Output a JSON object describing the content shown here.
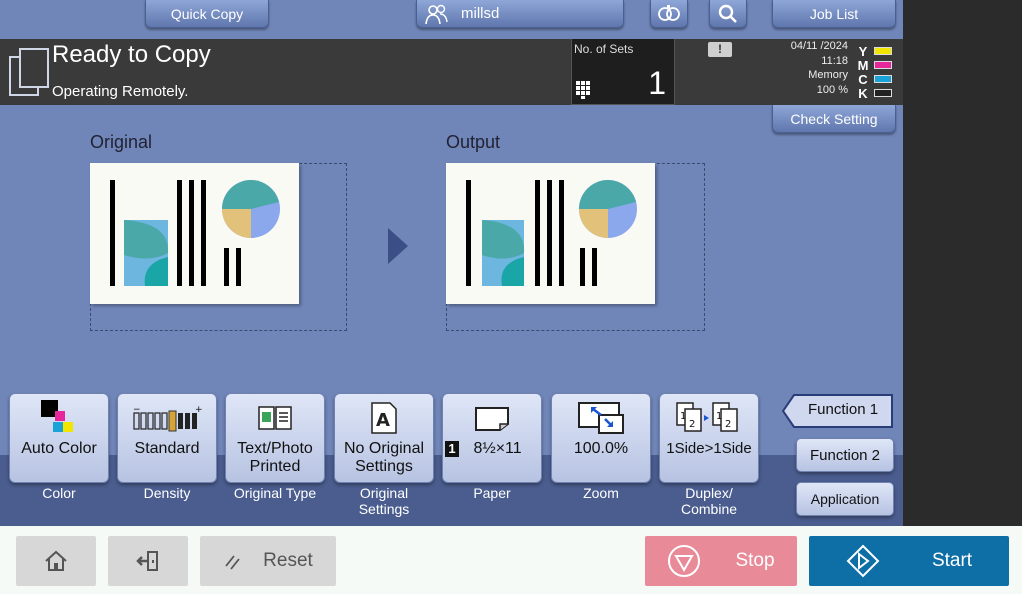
{
  "top_tabs": {
    "quick_copy": "Quick Copy",
    "user_name": "millsd",
    "job_list": "Job List",
    "connection_icon": "remote-connection-icon",
    "search_icon": "search-icon"
  },
  "status": {
    "title": "Ready to Copy",
    "subtitle": "Operating Remotely.",
    "sets_label": "No. of Sets",
    "sets_value": "1",
    "date": "04/11 /2024",
    "time": "11:18",
    "memory_label": "Memory",
    "memory_value": "100 %",
    "toner": [
      {
        "label": "Y",
        "color": "#f2e600"
      },
      {
        "label": "M",
        "color": "#e6269a"
      },
      {
        "label": "C",
        "color": "#1aa3d9"
      },
      {
        "label": "K",
        "color": "#222222"
      }
    ]
  },
  "check_setting": "Check Setting",
  "preview": {
    "original_label": "Original",
    "output_label": "Output"
  },
  "functions": [
    {
      "label": "Auto Color",
      "caption": "Color",
      "icon": "color-squares-icon"
    },
    {
      "label": "Standard",
      "caption": "Density",
      "icon": "density-scale-icon"
    },
    {
      "label": "Text/Photo\nPrinted",
      "caption": "Original Type",
      "icon": "original-type-icon"
    },
    {
      "label": "No Original\nSettings",
      "caption": "Original\nSettings",
      "icon": "original-settings-icon"
    },
    {
      "label": "8½×11",
      "caption": "Paper",
      "tray": "1",
      "icon": "paper-icon"
    },
    {
      "label": "100.0%",
      "caption": "Zoom",
      "icon": "zoom-icon"
    },
    {
      "label": "1Side>1Side",
      "caption": "Duplex/\nCombine",
      "icon": "duplex-icon"
    }
  ],
  "function_tabs": {
    "function1": "Function 1",
    "function2": "Function 2",
    "application": "Application"
  },
  "bottom": {
    "reset": "Reset",
    "stop": "Stop",
    "start": "Start"
  },
  "colors": {
    "screen_bg": "#7086b8",
    "status_bar": "#3a3a3a",
    "stop": "#e88a98",
    "start": "#0e6ea6"
  }
}
